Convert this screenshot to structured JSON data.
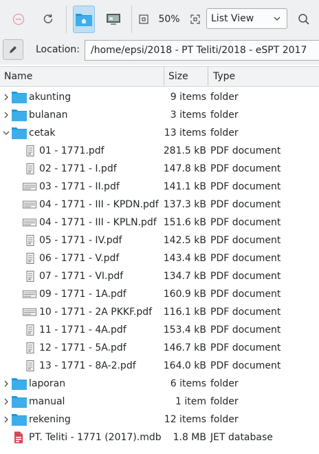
{
  "toolbar": {
    "zoom": "50%",
    "view_mode": "List View"
  },
  "location": {
    "label": "Location:",
    "path": "/home/epsi/2018 - PT Teliti/2018 - eSPT 2017"
  },
  "columns": {
    "name": "Name",
    "size": "Size",
    "type": "Type"
  },
  "rows": [
    {
      "name": "akunting",
      "size": "9 items",
      "type": "folder",
      "kind": "folder",
      "expanded": false
    },
    {
      "name": "bulanan",
      "size": "3 items",
      "type": "folder",
      "kind": "folder",
      "expanded": false
    },
    {
      "name": "cetak",
      "size": "13 items",
      "type": "folder",
      "kind": "folder",
      "expanded": true
    },
    {
      "name": "01 - 1771.pdf",
      "size": "281.5 kB",
      "type": "PDF document",
      "kind": "pdf-portrait"
    },
    {
      "name": "02 - 1771 - I.pdf",
      "size": "147.8 kB",
      "type": "PDF document",
      "kind": "pdf-portrait"
    },
    {
      "name": "03 - 1771 - II.pdf",
      "size": "141.1 kB",
      "type": "PDF document",
      "kind": "pdf-landscape"
    },
    {
      "name": "04 - 1771 - III - KPDN.pdf",
      "size": "137.3 kB",
      "type": "PDF document",
      "kind": "pdf-landscape"
    },
    {
      "name": "04 - 1771 - III - KPLN.pdf",
      "size": "151.6 kB",
      "type": "PDF document",
      "kind": "pdf-landscape"
    },
    {
      "name": "05 - 1771 - IV.pdf",
      "size": "142.5 kB",
      "type": "PDF document",
      "kind": "pdf-portrait"
    },
    {
      "name": "06 - 1771 - V.pdf",
      "size": "143.4 kB",
      "type": "PDF document",
      "kind": "pdf-portrait"
    },
    {
      "name": "07 - 1771 - VI.pdf",
      "size": "134.7 kB",
      "type": "PDF document",
      "kind": "pdf-portrait"
    },
    {
      "name": "09 - 1771 - 1A.pdf",
      "size": "160.9 kB",
      "type": "PDF document",
      "kind": "pdf-landscape"
    },
    {
      "name": "10 - 1771 - 2A PKKF.pdf",
      "size": "116.1 kB",
      "type": "PDF document",
      "kind": "pdf-landscape"
    },
    {
      "name": "11 - 1771 - 4A.pdf",
      "size": "153.4 kB",
      "type": "PDF document",
      "kind": "pdf-portrait"
    },
    {
      "name": "12 - 1771 - 5A.pdf",
      "size": "146.7 kB",
      "type": "PDF document",
      "kind": "pdf-portrait"
    },
    {
      "name": "13 - 1771 - 8A-2.pdf",
      "size": "164.0 kB",
      "type": "PDF document",
      "kind": "pdf-portrait"
    },
    {
      "name": "laporan",
      "size": "6 items",
      "type": "folder",
      "kind": "folder",
      "expanded": false
    },
    {
      "name": "manual",
      "size": "1 item",
      "type": "folder",
      "kind": "folder",
      "expanded": false
    },
    {
      "name": "rekening",
      "size": "12 items",
      "type": "folder",
      "kind": "folder",
      "expanded": false
    },
    {
      "name": "PT. Teliti - 1771 (2017).mdb",
      "size": "1.8 MB",
      "type": "JET database",
      "kind": "database"
    }
  ],
  "colors": {
    "folder": "#3daee9",
    "folder_tab": "#1d99d9",
    "active_button": "#bfdff4",
    "database": "#da4453"
  }
}
